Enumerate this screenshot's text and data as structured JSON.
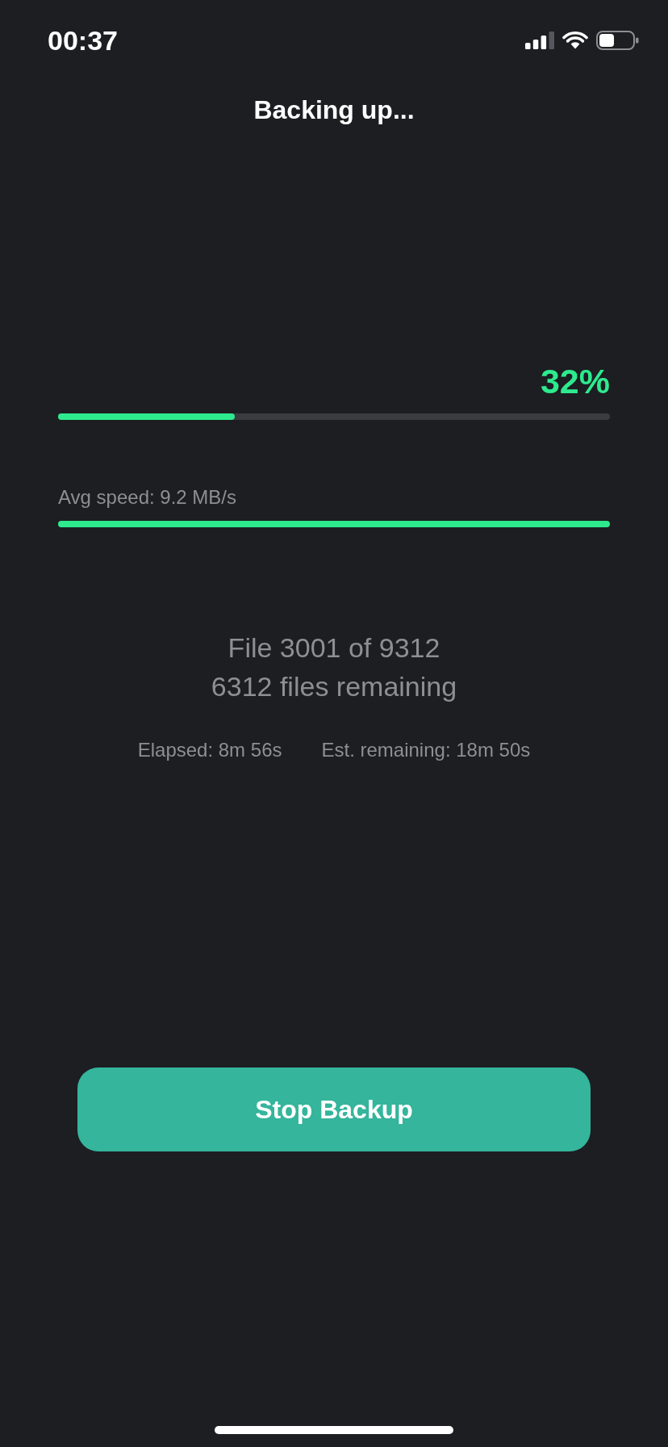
{
  "status_bar": {
    "time": "00:37"
  },
  "title": "Backing up...",
  "progress": {
    "percent": "32%",
    "level": 0.32
  },
  "speed": {
    "label": "Avg speed: 9.2 MB/s"
  },
  "file_count": "File 3001 of 9312",
  "files_remaining": "6312 files remaining",
  "times": [
    {
      "label": "Elapsed: 8m 56s"
    },
    {
      "label": "Est. remaining: 18m 50s"
    }
  ],
  "button": {
    "label": "Stop Backup"
  }
}
